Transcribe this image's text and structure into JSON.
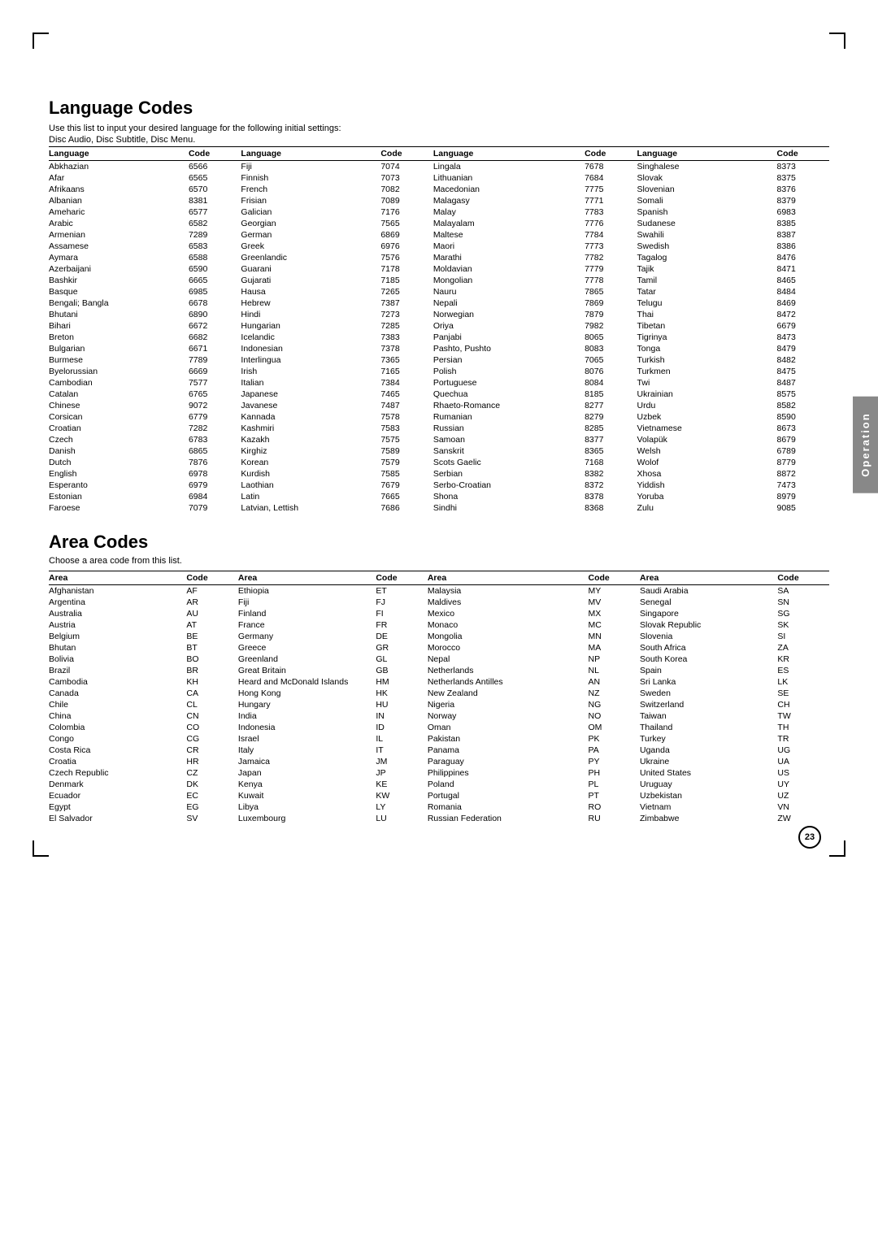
{
  "page": {
    "title": "Language Codes",
    "subtitle1": "Use this list to input your desired language for the following initial settings:",
    "subtitle2": "Disc Audio, Disc Subtitle, Disc Menu.",
    "area_title": "Area Codes",
    "area_subtitle": "Choose a area code from this list.",
    "side_tab": "Operation",
    "page_number": "23"
  },
  "lang_headers": [
    "Language",
    "Code",
    "Language",
    "Code",
    "Language",
    "Code",
    "Language",
    "Code"
  ],
  "lang_col1": [
    [
      "Abkhazian",
      "6566"
    ],
    [
      "Afar",
      "6565"
    ],
    [
      "Afrikaans",
      "6570"
    ],
    [
      "Albanian",
      "8381"
    ],
    [
      "Ameharic",
      "6577"
    ],
    [
      "Arabic",
      "6582"
    ],
    [
      "Armenian",
      "7289"
    ],
    [
      "Assamese",
      "6583"
    ],
    [
      "Aymara",
      "6588"
    ],
    [
      "Azerbaijani",
      "6590"
    ],
    [
      "Bashkir",
      "6665"
    ],
    [
      "Basque",
      "6985"
    ],
    [
      "Bengali; Bangla",
      "6678"
    ],
    [
      "Bhutani",
      "6890"
    ],
    [
      "Bihari",
      "6672"
    ],
    [
      "Breton",
      "6682"
    ],
    [
      "Bulgarian",
      "6671"
    ],
    [
      "Burmese",
      "7789"
    ],
    [
      "Byelorussian",
      "6669"
    ],
    [
      "Cambodian",
      "7577"
    ],
    [
      "Catalan",
      "6765"
    ],
    [
      "Chinese",
      "9072"
    ],
    [
      "Corsican",
      "6779"
    ],
    [
      "Croatian",
      "7282"
    ],
    [
      "Czech",
      "6783"
    ],
    [
      "Danish",
      "6865"
    ],
    [
      "Dutch",
      "7876"
    ],
    [
      "English",
      "6978"
    ],
    [
      "Esperanto",
      "6979"
    ],
    [
      "Estonian",
      "6984"
    ],
    [
      "Faroese",
      "7079"
    ]
  ],
  "lang_col2": [
    [
      "Fiji",
      "7074"
    ],
    [
      "Finnish",
      "7073"
    ],
    [
      "French",
      "7082"
    ],
    [
      "Frisian",
      "7089"
    ],
    [
      "Galician",
      "7176"
    ],
    [
      "Georgian",
      "7565"
    ],
    [
      "German",
      "6869"
    ],
    [
      "Greek",
      "6976"
    ],
    [
      "Greenlandic",
      "7576"
    ],
    [
      "Guarani",
      "7178"
    ],
    [
      "Gujarati",
      "7185"
    ],
    [
      "Hausa",
      "7265"
    ],
    [
      "Hebrew",
      "7387"
    ],
    [
      "Hindi",
      "7273"
    ],
    [
      "Hungarian",
      "7285"
    ],
    [
      "Icelandic",
      "7383"
    ],
    [
      "Indonesian",
      "7378"
    ],
    [
      "Interlingua",
      "7365"
    ],
    [
      "Irish",
      "7165"
    ],
    [
      "Italian",
      "7384"
    ],
    [
      "Japanese",
      "7465"
    ],
    [
      "Javanese",
      "7487"
    ],
    [
      "Kannada",
      "7578"
    ],
    [
      "Kashmiri",
      "7583"
    ],
    [
      "Kazakh",
      "7575"
    ],
    [
      "Kirghiz",
      "7589"
    ],
    [
      "Korean",
      "7579"
    ],
    [
      "Kurdish",
      "7585"
    ],
    [
      "Laothian",
      "7679"
    ],
    [
      "Latin",
      "7665"
    ],
    [
      "Latvian, Lettish",
      "7686"
    ]
  ],
  "lang_col3": [
    [
      "Lingala",
      "7678"
    ],
    [
      "Lithuanian",
      "7684"
    ],
    [
      "Macedonian",
      "7775"
    ],
    [
      "Malagasy",
      "7771"
    ],
    [
      "Malay",
      "7783"
    ],
    [
      "Malayalam",
      "7776"
    ],
    [
      "Maltese",
      "7784"
    ],
    [
      "Maori",
      "7773"
    ],
    [
      "Marathi",
      "7782"
    ],
    [
      "Moldavian",
      "7779"
    ],
    [
      "Mongolian",
      "7778"
    ],
    [
      "Nauru",
      "7865"
    ],
    [
      "Nepali",
      "7869"
    ],
    [
      "Norwegian",
      "7879"
    ],
    [
      "Oriya",
      "7982"
    ],
    [
      "Panjabi",
      "8065"
    ],
    [
      "Pashto, Pushto",
      "8083"
    ],
    [
      "Persian",
      "7065"
    ],
    [
      "Polish",
      "8076"
    ],
    [
      "Portuguese",
      "8084"
    ],
    [
      "Quechua",
      "8185"
    ],
    [
      "Rhaeto-Romance",
      "8277"
    ],
    [
      "Rumanian",
      "8279"
    ],
    [
      "Russian",
      "8285"
    ],
    [
      "Samoan",
      "8377"
    ],
    [
      "Sanskrit",
      "8365"
    ],
    [
      "Scots Gaelic",
      "7168"
    ],
    [
      "Serbian",
      "8382"
    ],
    [
      "Serbo-Croatian",
      "8372"
    ],
    [
      "Shona",
      "8378"
    ],
    [
      "Sindhi",
      "8368"
    ]
  ],
  "lang_col4": [
    [
      "Singhalese",
      "8373"
    ],
    [
      "Slovak",
      "8375"
    ],
    [
      "Slovenian",
      "8376"
    ],
    [
      "Somali",
      "8379"
    ],
    [
      "Spanish",
      "6983"
    ],
    [
      "Sudanese",
      "8385"
    ],
    [
      "Swahili",
      "8387"
    ],
    [
      "Swedish",
      "8386"
    ],
    [
      "Tagalog",
      "8476"
    ],
    [
      "Tajik",
      "8471"
    ],
    [
      "Tamil",
      "8465"
    ],
    [
      "Tatar",
      "8484"
    ],
    [
      "Telugu",
      "8469"
    ],
    [
      "Thai",
      "8472"
    ],
    [
      "Tibetan",
      "6679"
    ],
    [
      "Tigrinya",
      "8473"
    ],
    [
      "Tonga",
      "8479"
    ],
    [
      "Turkish",
      "8482"
    ],
    [
      "Turkmen",
      "8475"
    ],
    [
      "Twi",
      "8487"
    ],
    [
      "Ukrainian",
      "8575"
    ],
    [
      "Urdu",
      "8582"
    ],
    [
      "Uzbek",
      "8590"
    ],
    [
      "Vietnamese",
      "8673"
    ],
    [
      "Volapük",
      "8679"
    ],
    [
      "Welsh",
      "6789"
    ],
    [
      "Wolof",
      "8779"
    ],
    [
      "Xhosa",
      "8872"
    ],
    [
      "Yiddish",
      "7473"
    ],
    [
      "Yoruba",
      "8979"
    ],
    [
      "Zulu",
      "9085"
    ]
  ],
  "area_headers": [
    "Area",
    "Code",
    "Area",
    "Code",
    "Area",
    "Code",
    "Area",
    "Code"
  ],
  "area_col1": [
    [
      "Afghanistan",
      "AF"
    ],
    [
      "Argentina",
      "AR"
    ],
    [
      "Australia",
      "AU"
    ],
    [
      "Austria",
      "AT"
    ],
    [
      "Belgium",
      "BE"
    ],
    [
      "Bhutan",
      "BT"
    ],
    [
      "Bolivia",
      "BO"
    ],
    [
      "Brazil",
      "BR"
    ],
    [
      "Cambodia",
      "KH"
    ],
    [
      "Canada",
      "CA"
    ],
    [
      "Chile",
      "CL"
    ],
    [
      "China",
      "CN"
    ],
    [
      "Colombia",
      "CO"
    ],
    [
      "Congo",
      "CG"
    ],
    [
      "Costa Rica",
      "CR"
    ],
    [
      "Croatia",
      "HR"
    ],
    [
      "Czech Republic",
      "CZ"
    ],
    [
      "Denmark",
      "DK"
    ],
    [
      "Ecuador",
      "EC"
    ],
    [
      "Egypt",
      "EG"
    ],
    [
      "El Salvador",
      "SV"
    ]
  ],
  "area_col2": [
    [
      "Ethiopia",
      "ET"
    ],
    [
      "Fiji",
      "FJ"
    ],
    [
      "Finland",
      "FI"
    ],
    [
      "France",
      "FR"
    ],
    [
      "Germany",
      "DE"
    ],
    [
      "Greece",
      "GR"
    ],
    [
      "Greenland",
      "GL"
    ],
    [
      "Great Britain",
      "GB"
    ],
    [
      "Heard and McDonald Islands",
      "HM"
    ],
    [
      "Hong Kong",
      "HK"
    ],
    [
      "Hungary",
      "HU"
    ],
    [
      "India",
      "IN"
    ],
    [
      "Indonesia",
      "ID"
    ],
    [
      "Israel",
      "IL"
    ],
    [
      "Italy",
      "IT"
    ],
    [
      "Jamaica",
      "JM"
    ],
    [
      "Japan",
      "JP"
    ],
    [
      "Kenya",
      "KE"
    ],
    [
      "Kuwait",
      "KW"
    ],
    [
      "Libya",
      "LY"
    ],
    [
      "Luxembourg",
      "LU"
    ]
  ],
  "area_col3": [
    [
      "Malaysia",
      "MY"
    ],
    [
      "Maldives",
      "MV"
    ],
    [
      "Mexico",
      "MX"
    ],
    [
      "Monaco",
      "MC"
    ],
    [
      "Mongolia",
      "MN"
    ],
    [
      "Morocco",
      "MA"
    ],
    [
      "Nepal",
      "NP"
    ],
    [
      "Netherlands",
      "NL"
    ],
    [
      "Netherlands Antilles",
      "AN"
    ],
    [
      "New Zealand",
      "NZ"
    ],
    [
      "Nigeria",
      "NG"
    ],
    [
      "Norway",
      "NO"
    ],
    [
      "Oman",
      "OM"
    ],
    [
      "Pakistan",
      "PK"
    ],
    [
      "Panama",
      "PA"
    ],
    [
      "Paraguay",
      "PY"
    ],
    [
      "Philippines",
      "PH"
    ],
    [
      "Poland",
      "PL"
    ],
    [
      "Portugal",
      "PT"
    ],
    [
      "Romania",
      "RO"
    ],
    [
      "Russian Federation",
      "RU"
    ]
  ],
  "area_col4": [
    [
      "Saudi Arabia",
      "SA"
    ],
    [
      "Senegal",
      "SN"
    ],
    [
      "Singapore",
      "SG"
    ],
    [
      "Slovak Republic",
      "SK"
    ],
    [
      "Slovenia",
      "SI"
    ],
    [
      "South Africa",
      "ZA"
    ],
    [
      "South Korea",
      "KR"
    ],
    [
      "Spain",
      "ES"
    ],
    [
      "Sri Lanka",
      "LK"
    ],
    [
      "Sweden",
      "SE"
    ],
    [
      "Switzerland",
      "CH"
    ],
    [
      "Taiwan",
      "TW"
    ],
    [
      "Thailand",
      "TH"
    ],
    [
      "Turkey",
      "TR"
    ],
    [
      "Uganda",
      "UG"
    ],
    [
      "Ukraine",
      "UA"
    ],
    [
      "United States",
      "US"
    ],
    [
      "Uruguay",
      "UY"
    ],
    [
      "Uzbekistan",
      "UZ"
    ],
    [
      "Vietnam",
      "VN"
    ],
    [
      "Zimbabwe",
      "ZW"
    ]
  ]
}
